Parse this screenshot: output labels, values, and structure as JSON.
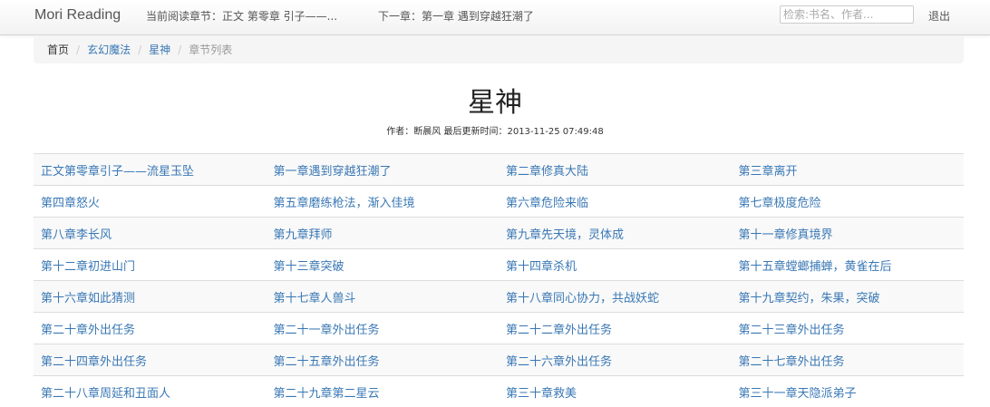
{
  "navbar": {
    "brand": "Mori Reading",
    "current_chapter": "当前阅读章节：正文 第零章 引子——...",
    "next_chapter": "下一章：第一章 遇到穿越狂潮了",
    "search_placeholder": "检索:书名、作者...",
    "logout": "退出"
  },
  "breadcrumb": {
    "home": "首页",
    "category": "玄幻魔法",
    "book": "星神",
    "current": "章节列表",
    "separator": "/"
  },
  "book": {
    "title": "星神",
    "meta": "作者：断晨风 最后更新时间：2013-11-25 07:49:48"
  },
  "chapters": [
    [
      "正文第零章引子——流星玉坠",
      "第一章遇到穿越狂潮了",
      "第二章修真大陆",
      "第三章离开"
    ],
    [
      "第四章怒火",
      "第五章磨练枪法，渐入佳境",
      "第六章危险来临",
      "第七章极度危险"
    ],
    [
      "第八章李长风",
      "第九章拜师",
      "第九章先天境，灵体成",
      "第十一章修真境界"
    ],
    [
      "第十二章初进山门",
      "第十三章突破",
      "第十四章杀机",
      "第十五章螳螂捕蝉，黄雀在后"
    ],
    [
      "第十六章如此猜测",
      "第十七章人兽斗",
      "第十八章同心协力，共战妖蛇",
      "第十九章契约，朱果，突破"
    ],
    [
      "第二十章外出任务",
      "第二十一章外出任务",
      "第二十二章外出任务",
      "第二十三章外出任务"
    ],
    [
      "第二十四章外出任务",
      "第二十五章外出任务",
      "第二十六章外出任务",
      "第二十七章外出任务"
    ],
    [
      "第二十八章周延和丑面人",
      "第二十九章第二星云",
      "第三十章救美",
      "第三十一章天隐派弟子"
    ]
  ],
  "colors": {
    "link": "#3a78b5",
    "row_striped": "#f9f9f9",
    "breadcrumb_bg": "#f5f5f5"
  }
}
